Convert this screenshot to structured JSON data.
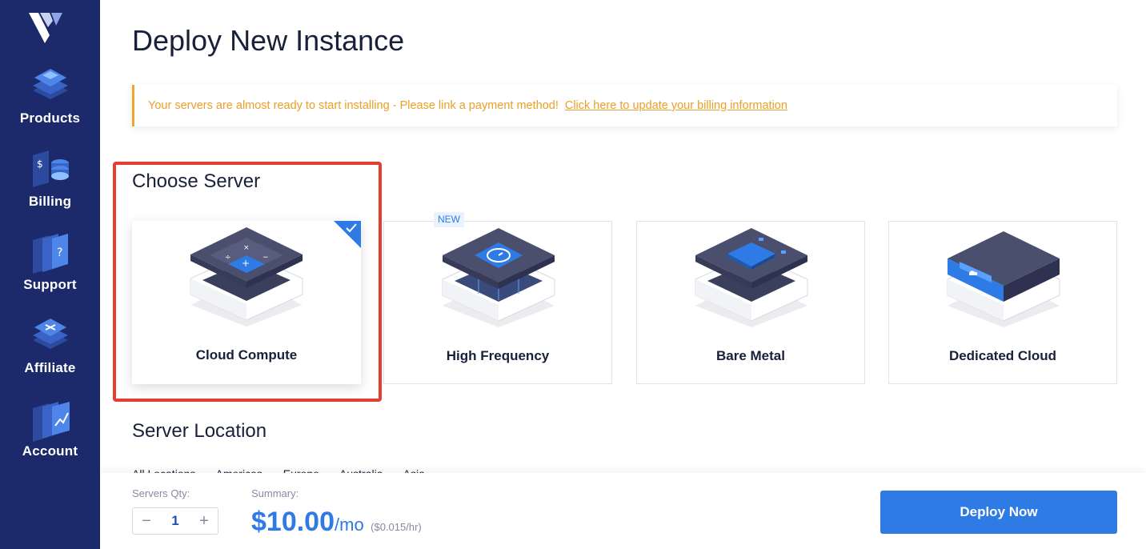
{
  "sidebar": {
    "logo_icon": "vultr-logo-icon",
    "items": [
      {
        "label": "Products",
        "icon": "products-icon"
      },
      {
        "label": "Billing",
        "icon": "billing-icon"
      },
      {
        "label": "Support",
        "icon": "support-icon"
      },
      {
        "label": "Affiliate",
        "icon": "affiliate-icon"
      },
      {
        "label": "Account",
        "icon": "account-icon"
      }
    ]
  },
  "page": {
    "title": "Deploy New Instance"
  },
  "alert": {
    "message": "Your servers are almost ready to start installing - Please link a payment method!",
    "link_text": "Click here to update your billing information",
    "color": "#eb9f27"
  },
  "choose_server": {
    "title": "Choose Server",
    "options": [
      {
        "label": "Cloud Compute",
        "selected": true,
        "badge": ""
      },
      {
        "label": "High Frequency",
        "selected": false,
        "badge": "NEW"
      },
      {
        "label": "Bare Metal",
        "selected": false,
        "badge": ""
      },
      {
        "label": "Dedicated Cloud",
        "selected": false,
        "badge": ""
      }
    ]
  },
  "server_location": {
    "title": "Server Location",
    "filters": [
      "All Locations",
      "Americas",
      "Europe",
      "Australia",
      "Asia"
    ]
  },
  "footer": {
    "qty_label": "Servers Qty:",
    "qty_value": "1",
    "decrement": "−",
    "increment": "+",
    "summary_label": "Summary:",
    "price": "$10.00",
    "price_unit": "/mo",
    "price_hourly": "($0.015/hr)",
    "deploy_label": "Deploy Now"
  },
  "colors": {
    "sidebar": "#1c2a6b",
    "accent": "#2f7be6",
    "highlight": "#e53d2f"
  }
}
